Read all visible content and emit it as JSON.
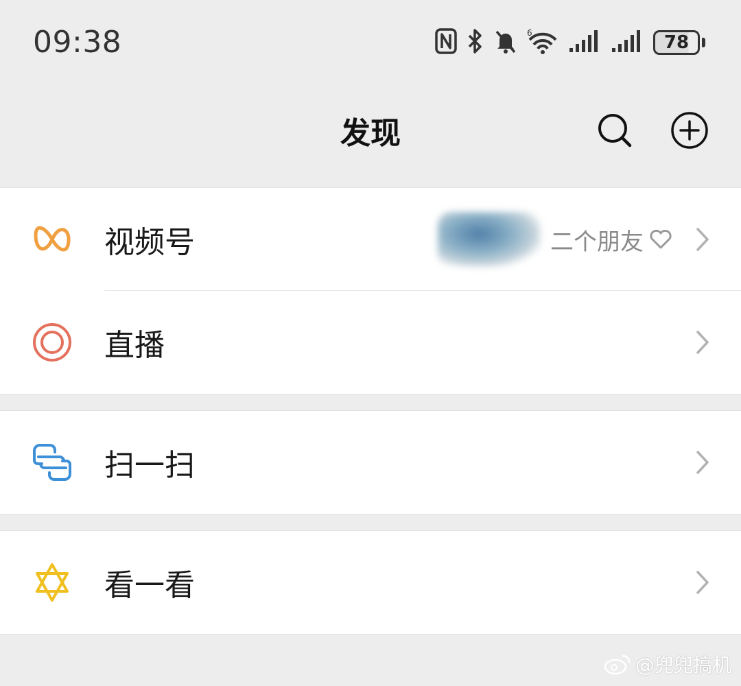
{
  "status_bar": {
    "time": "09:38",
    "battery_level": "78",
    "icons": [
      "nfc-icon",
      "bluetooth-icon",
      "mute-icon",
      "wifi-icon",
      "signal-icon",
      "signal-icon",
      "battery-icon"
    ]
  },
  "nav": {
    "title": "发现",
    "actions": [
      "search-icon",
      "add-icon"
    ]
  },
  "groups": [
    {
      "items": [
        {
          "label": "视频号",
          "icon": "channels-icon",
          "color": "#f0a040",
          "extra": "二个朋友"
        },
        {
          "label": "直播",
          "icon": "live-icon",
          "color": "#e4715d"
        }
      ]
    },
    {
      "items": [
        {
          "label": "扫一扫",
          "icon": "scan-icon",
          "color": "#3d8fd8"
        }
      ]
    },
    {
      "items": [
        {
          "label": "看一看",
          "icon": "top-stories-icon",
          "color": "#f0c020"
        }
      ]
    }
  ],
  "watermark": "@兜兜搞机",
  "colors": {
    "background": "#ededed",
    "card": "#ffffff",
    "chevron": "#b2b2b2"
  }
}
